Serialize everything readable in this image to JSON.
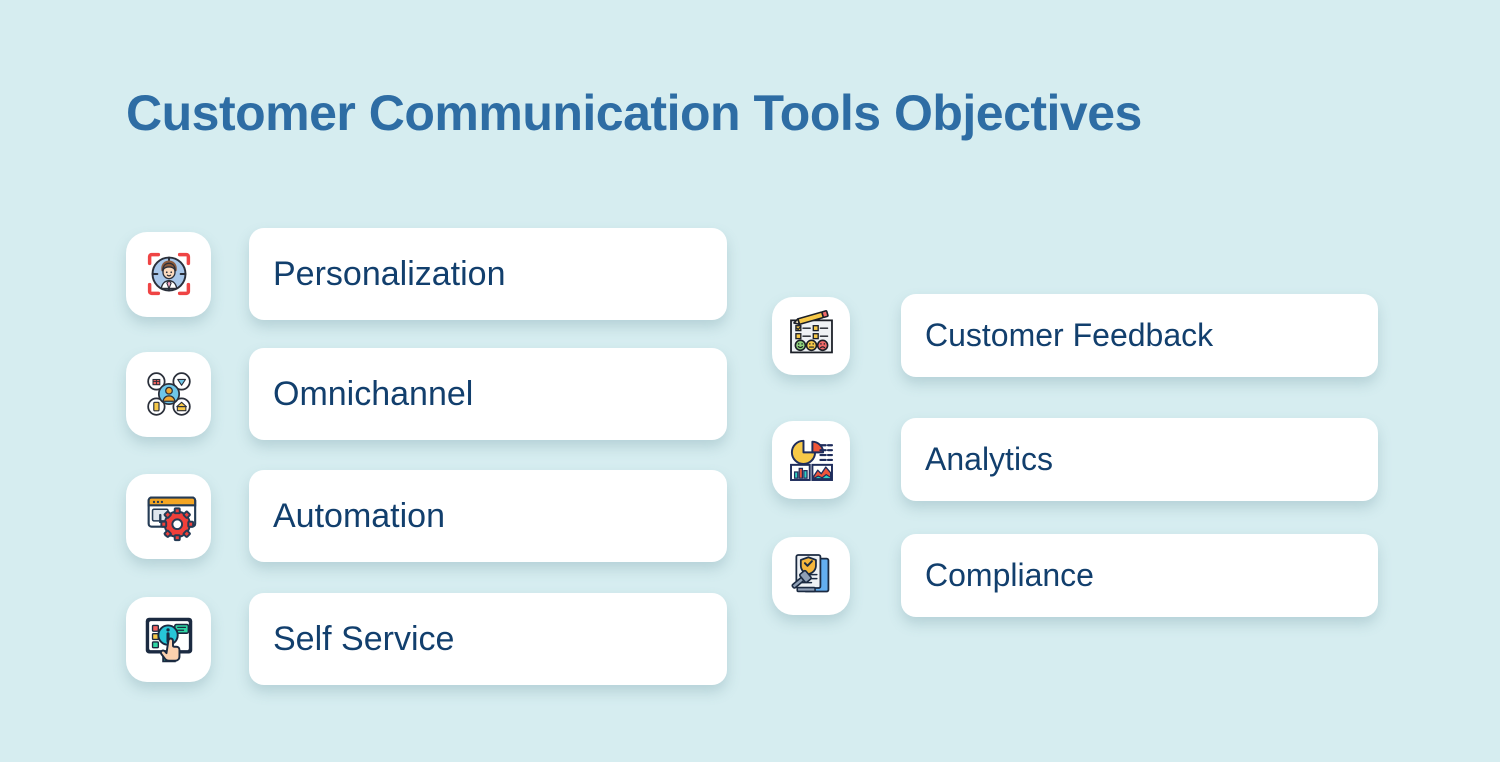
{
  "header": {
    "title": "Customer Communication Tools Objectives",
    "title_color": "#2e6da4"
  },
  "theme": {
    "background": "#d6edf0",
    "card_background": "#ffffff",
    "label_color": "#123f6d"
  },
  "columns": {
    "left": {
      "items": [
        {
          "label": "Personalization",
          "icon": "target-person-icon"
        },
        {
          "label": "Omnichannel",
          "icon": "channel-network-icon"
        },
        {
          "label": "Automation",
          "icon": "monitor-gear-icon"
        },
        {
          "label": "Self Service",
          "icon": "info-kiosk-hand-icon"
        }
      ]
    },
    "right": {
      "items": [
        {
          "label": "Customer Feedback",
          "icon": "survey-emoji-icon"
        },
        {
          "label": "Analytics",
          "icon": "charts-dashboard-icon"
        },
        {
          "label": "Compliance",
          "icon": "document-shield-gavel-icon"
        }
      ]
    }
  }
}
